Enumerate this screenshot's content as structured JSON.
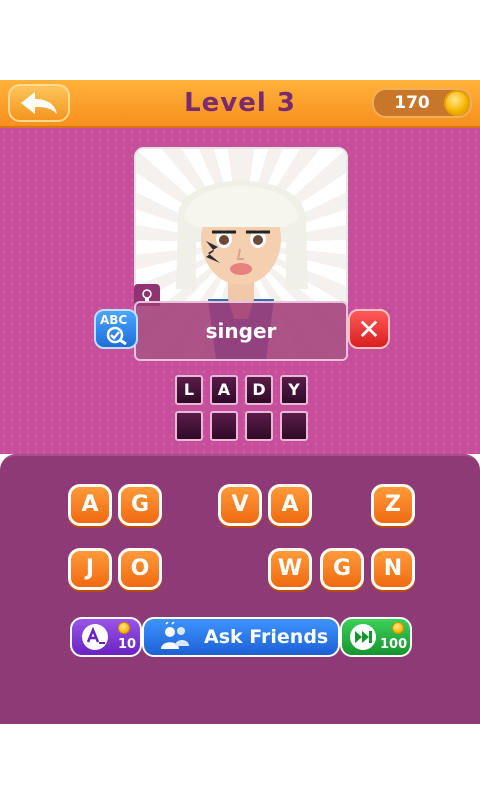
{
  "header": {
    "title": "Level  3",
    "coins": "170"
  },
  "puzzle": {
    "hint": "singer",
    "abc_label": "ABC",
    "close_symbol": "✕",
    "answer_row1": [
      "L",
      "A",
      "D",
      "Y"
    ],
    "answer_row2": [
      "",
      "",
      "",
      ""
    ]
  },
  "keyboard": {
    "row1": [
      "A",
      "G",
      "V",
      "A",
      "Z"
    ],
    "row2": [
      "J",
      "O",
      "W",
      "G",
      "N"
    ]
  },
  "actions": {
    "reveal_cost": "10",
    "ask_friends_label": "Ask Friends",
    "skip_cost": "100"
  },
  "colors": {
    "header_orange": "#f78f1e",
    "title_purple": "#7a2a6e",
    "play_pink": "#c64e9a",
    "keyboard_purple": "#8d3a77",
    "key_orange": "#f16a10"
  },
  "icons": [
    "back-arrow-icon",
    "coin-icon",
    "lightbulb-icon",
    "abc-check-icon",
    "close-icon",
    "reveal-letter-icon",
    "friends-icon",
    "skip-icon"
  ]
}
